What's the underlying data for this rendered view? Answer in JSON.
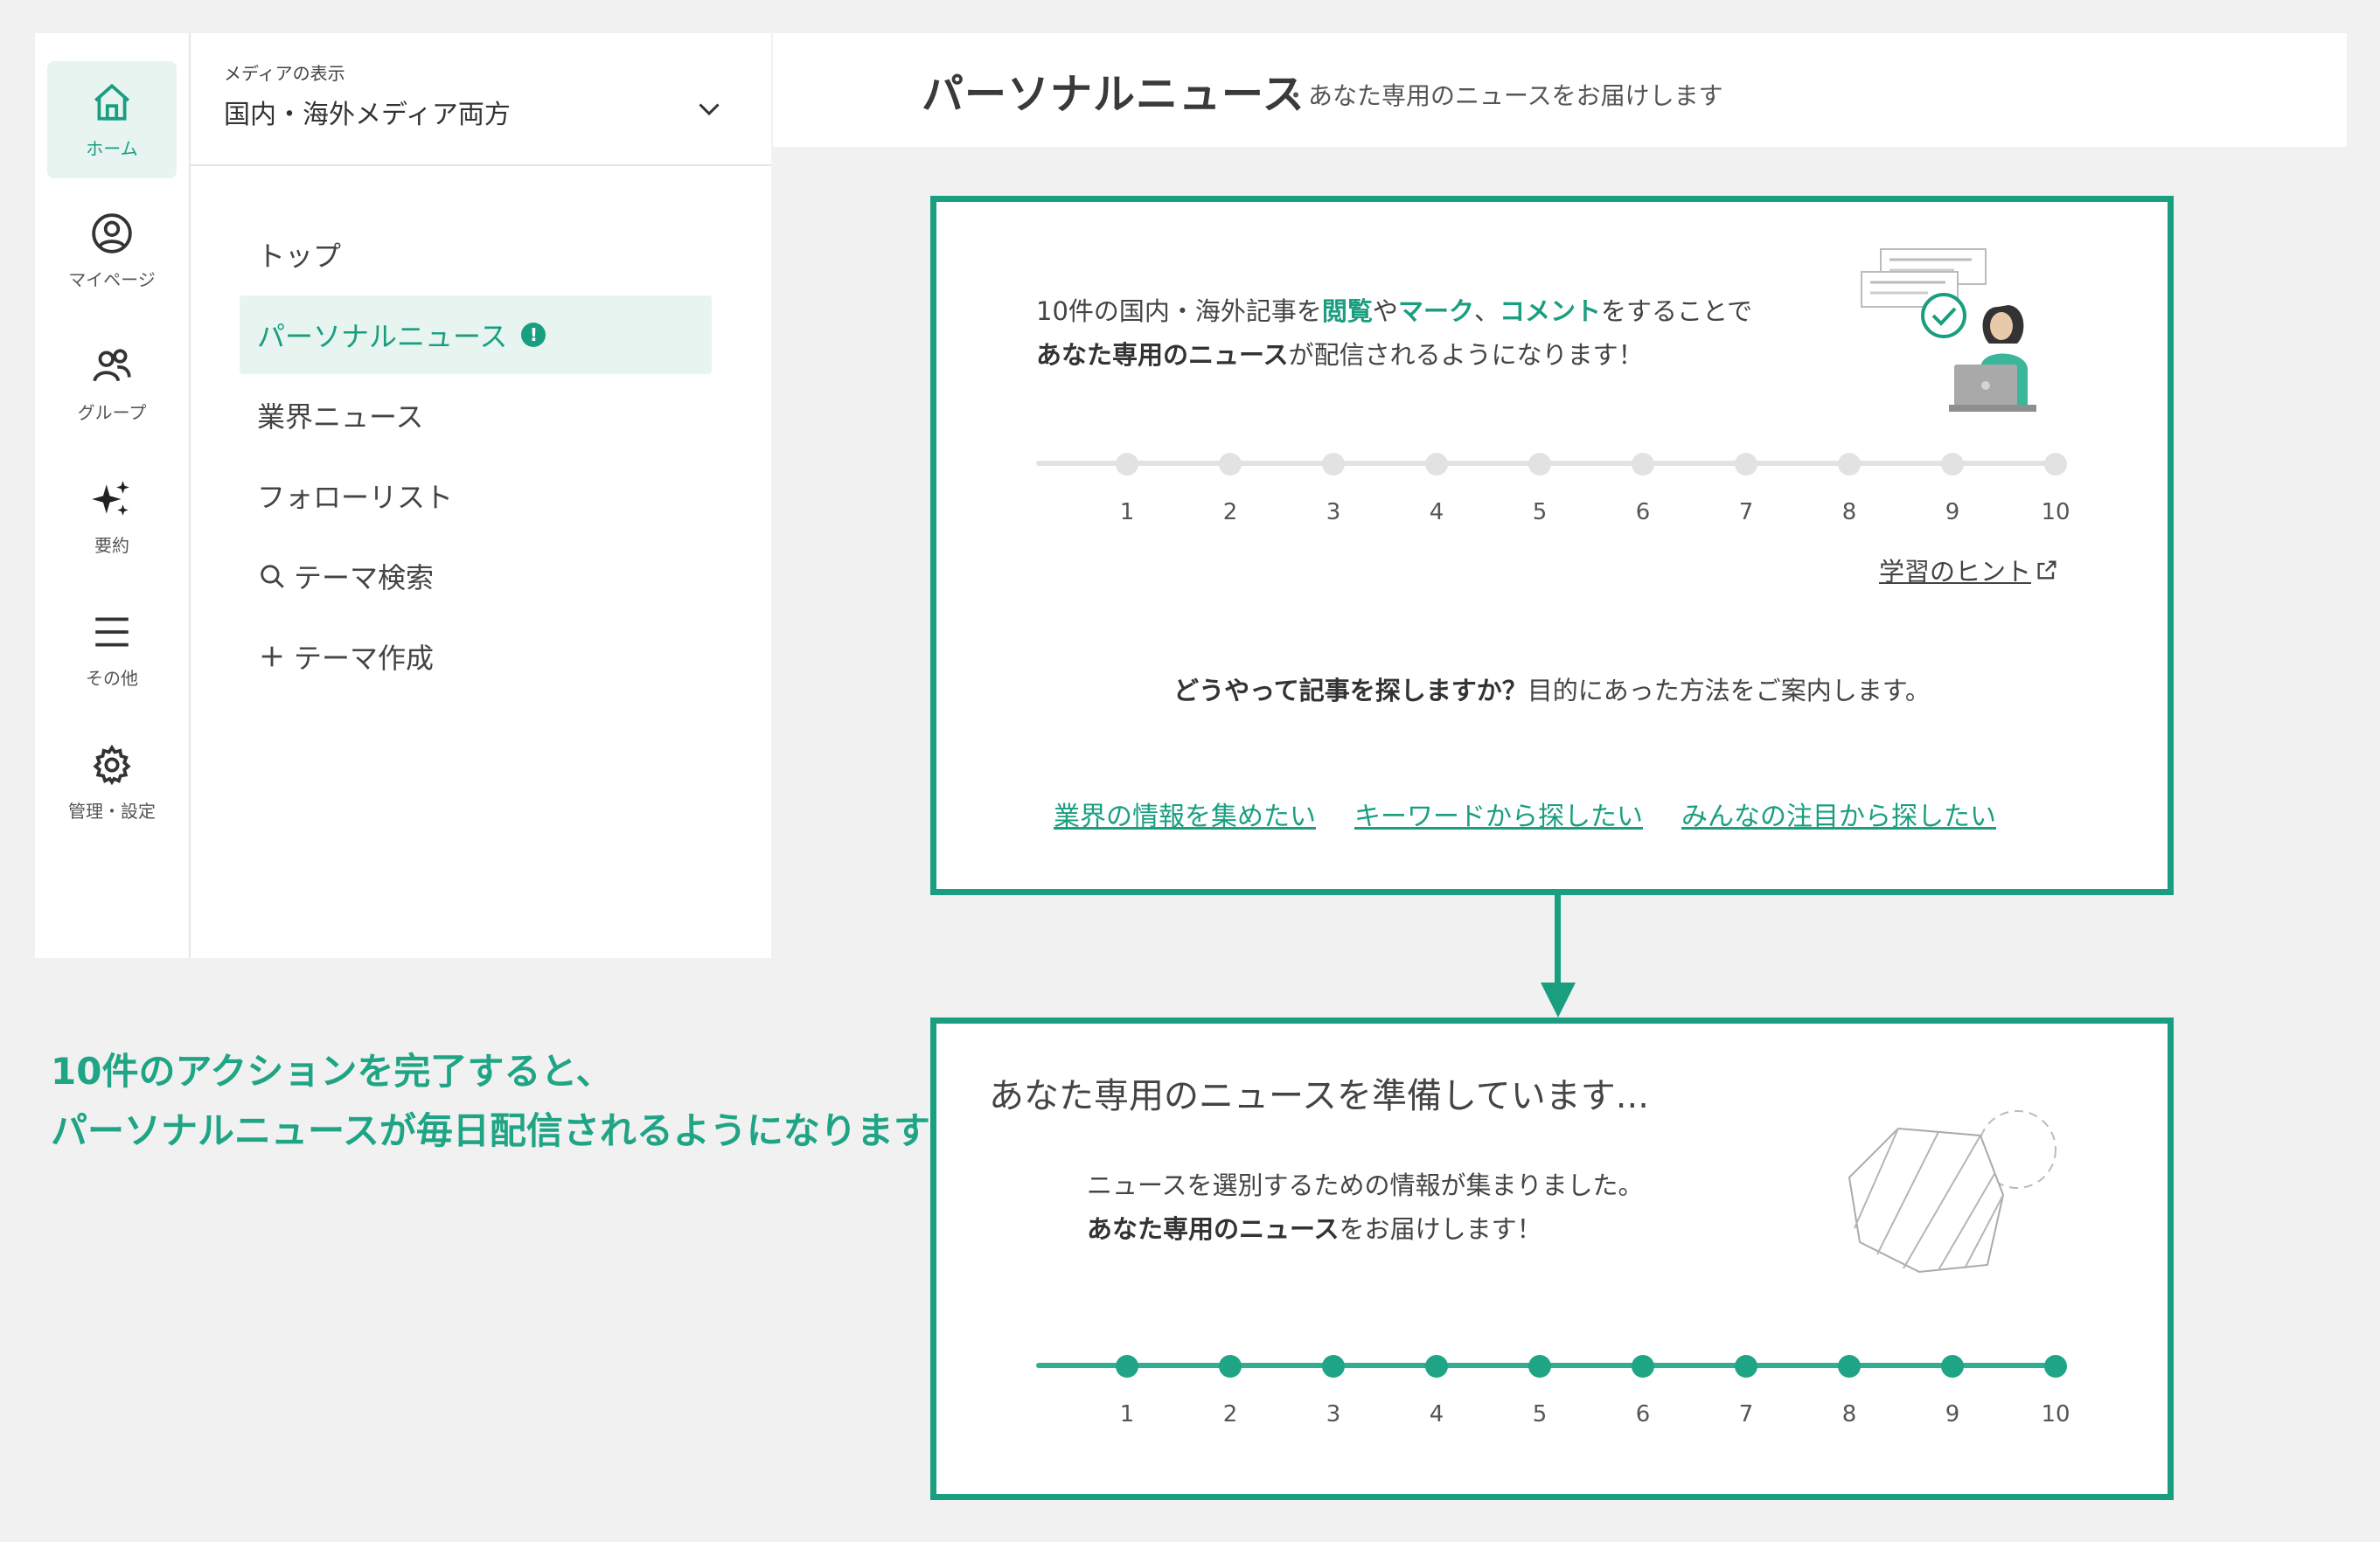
{
  "rail": {
    "items": [
      {
        "label": "ホーム",
        "icon": "home-icon"
      },
      {
        "label": "マイページ",
        "icon": "user-icon"
      },
      {
        "label": "グループ",
        "icon": "group-icon"
      },
      {
        "label": "要約",
        "icon": "sparkle-icon"
      },
      {
        "label": "その他",
        "icon": "menu-icon"
      },
      {
        "label": "管理・設定",
        "icon": "gear-icon"
      }
    ]
  },
  "media": {
    "caption": "メディアの表示",
    "value": "国内・海外メディア両方"
  },
  "subnav": {
    "top": "トップ",
    "personal": "パーソナルニュース",
    "badge": "!",
    "industry": "業界ニュース",
    "follow": "フォローリスト",
    "theme_search": "テーマ検索",
    "theme_create": "テーマ作成"
  },
  "header": {
    "title": "パーソナルニュース",
    "subtitle": "・あなた専用のニュースをお届けします"
  },
  "panel_top": {
    "intro_1a": "10件の国内・海外記事を",
    "intro_1b": "閲覧",
    "intro_1c": "や",
    "intro_1d": "マーク",
    "intro_1e": "、",
    "intro_1f": "コメント",
    "intro_1g": "をすることで",
    "intro_2a": "あなた専用のニュース",
    "intro_2b": "が配信されるようになります！",
    "hint": "学習のヒント",
    "question_bold": "どうやって記事を探しますか？",
    "question_rest": "目的にあった方法をご案内します。",
    "links": [
      "業界の情報を集めたい",
      "キーワードから探したい",
      "みんなの注目から探したい"
    ]
  },
  "panel_bottom": {
    "title": "あなた専用のニュースを準備しています...",
    "text_1": "ニュースを選別するための情報が集まりました。",
    "text_2a": "あなた専用のニュース",
    "text_2b": "をお届けします！"
  },
  "progress": {
    "ticks": [
      "1",
      "2",
      "3",
      "4",
      "5",
      "6",
      "7",
      "8",
      "9",
      "10"
    ],
    "before_completed": 0,
    "after_completed": 10,
    "total": 10
  },
  "caption": {
    "line1": "10件のアクションを完了すると、",
    "line2": "パーソナルニュースが毎日配信されるようになります"
  },
  "colors": {
    "accent": "#1a9e80",
    "track": "#e2e2e2"
  }
}
